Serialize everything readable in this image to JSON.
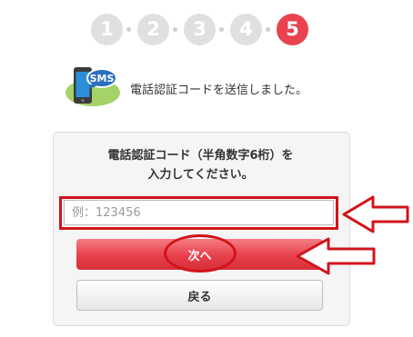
{
  "steps": [
    "1",
    "2",
    "3",
    "4",
    "5"
  ],
  "current_step": 5,
  "notice": {
    "icon_label": "SMS",
    "message": "電話認証コードを送信しました。"
  },
  "form": {
    "instruction_line1": "電話認証コード（半角数字6桁）を",
    "instruction_line2": "入力してください。",
    "code_placeholder": "例：123456",
    "code_value": "",
    "next_label": "次へ",
    "back_label": "戻る"
  },
  "colors": {
    "accent": "#e8434e",
    "annotation": "#d1141c",
    "step_inactive": "#e0e0e0"
  }
}
